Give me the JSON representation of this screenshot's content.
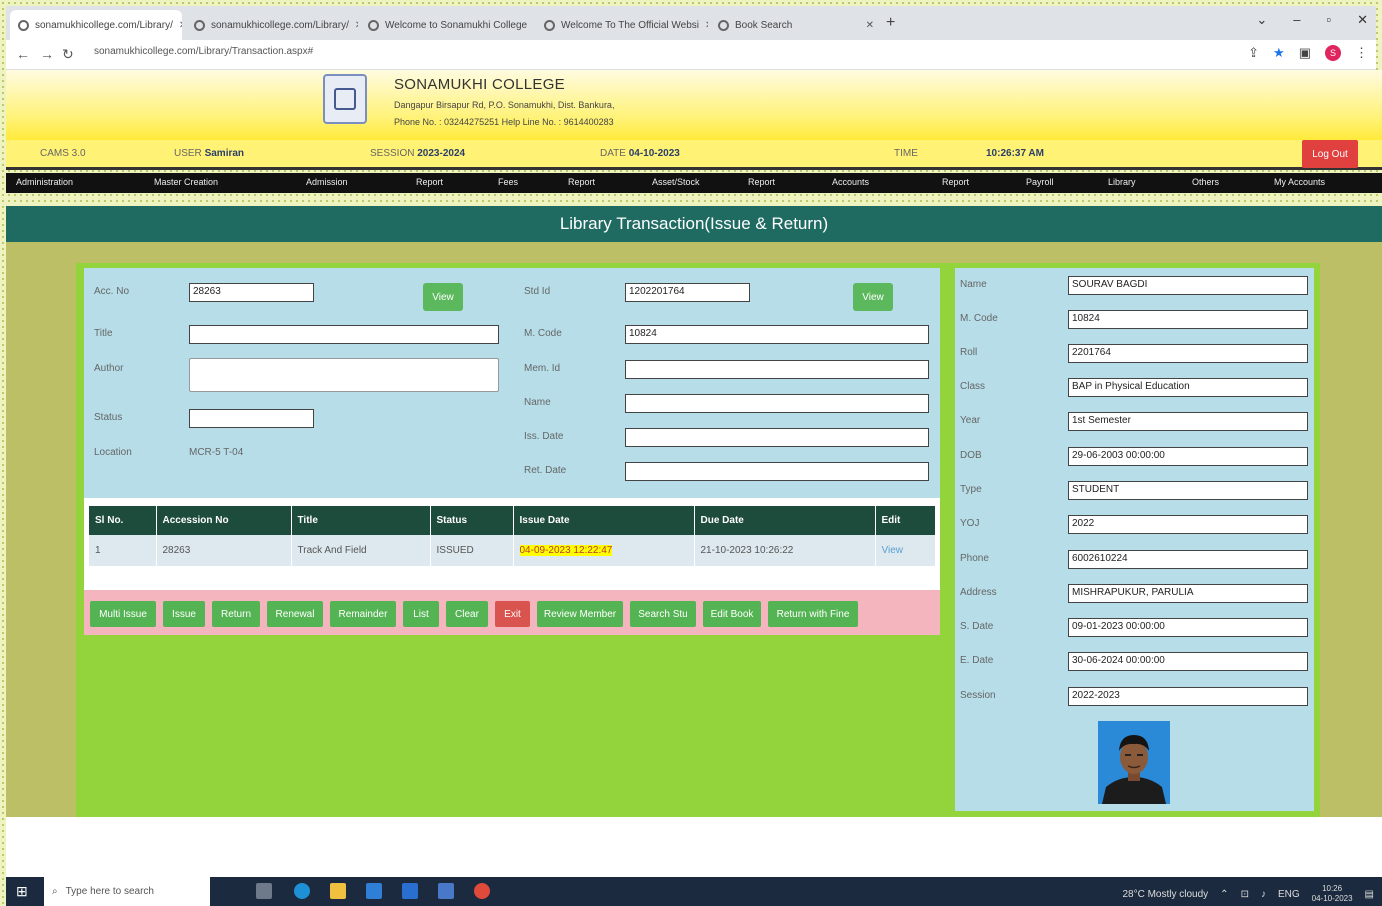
{
  "browser": {
    "tabs": [
      {
        "label": "sonamukhicollege.com/Library/"
      },
      {
        "label": "sonamukhicollege.com/Library/"
      },
      {
        "label": "Welcome to Sonamukhi College"
      },
      {
        "label": "Welcome To The Official Websi"
      },
      {
        "label": "Book Search"
      }
    ],
    "url": "sonamukhicollege.com/Library/Transaction.aspx#"
  },
  "site": {
    "college_name": "SONAMUKHI COLLEGE",
    "address": "Dangapur Birsapur Rd, P.O. Sonamukhi, Dist. Bankura,",
    "phone": "Phone No. : 03244275251  Help Line No. : 9614400283"
  },
  "info": {
    "cams_label": "CAMS 3.0",
    "user_label": "USER",
    "user_value": "Samiran",
    "session_label": "SESSION",
    "session_value": "2023-2024",
    "date_label": "DATE",
    "date_value": "04-10-2023",
    "time_label": "TIME",
    "time_value": "10:26:37 AM",
    "logout_label": "Log Out"
  },
  "menu": [
    "Administration",
    "Master Creation",
    "Admission",
    "Report",
    "Fees",
    "Report",
    "Asset/Stock",
    "Report",
    "Accounts",
    "Report",
    "Payroll",
    "Library",
    "Others",
    "My Accounts"
  ],
  "page_title": "Library Transaction(Issue & Return)",
  "form": {
    "acc_no_label": "Acc. No",
    "acc_no_value": "28263",
    "view_label": "View",
    "title_label": "Title",
    "author_label": "Author",
    "status_label": "Status",
    "location_label": "Location",
    "location_value": "MCR-5 T-04",
    "std_id_label": "Std Id",
    "std_id_value": "1202201764",
    "mcode_label": "M. Code",
    "mcode_value": "10824",
    "memid_label": "Mem. Id",
    "name_label": "Name",
    "issdate_label": "Iss. Date",
    "retdate_label": "Ret. Date"
  },
  "table": {
    "headers": [
      "Sl No.",
      "Accession No",
      "Title",
      "Status",
      "Issue Date",
      "Due Date",
      "Edit"
    ],
    "rows": [
      [
        "1",
        "28263",
        "Track And Field",
        "ISSUED",
        "04-09-2023 12:22:47",
        "21-10-2023 10:26:22",
        "View"
      ]
    ]
  },
  "buttons": [
    "Multi Issue",
    "Issue",
    "Return",
    "Renewal",
    "Remainder",
    "List",
    "Clear",
    "Exit",
    "Review Member",
    "Search Stu",
    "Edit Book",
    "Return with Fine"
  ],
  "member": [
    {
      "label": "Name",
      "value": "SOURAV BAGDI"
    },
    {
      "label": "M. Code",
      "value": "10824"
    },
    {
      "label": "Roll",
      "value": "2201764"
    },
    {
      "label": "Class",
      "value": "BAP in Physical Education"
    },
    {
      "label": "Year",
      "value": "1st Semester"
    },
    {
      "label": "DOB",
      "value": "29-06-2003 00:00:00"
    },
    {
      "label": "Type",
      "value": "STUDENT"
    },
    {
      "label": "YOJ",
      "value": "2022"
    },
    {
      "label": "Phone",
      "value": "6002610224"
    },
    {
      "label": "Address",
      "value": "MISHRAPUKUR, PARULIA"
    },
    {
      "label": "S. Date",
      "value": "09-01-2023 00:00:00"
    },
    {
      "label": "E. Date",
      "value": "30-06-2024 00:00:00"
    },
    {
      "label": "Session",
      "value": "2022-2023"
    }
  ],
  "taskbar": {
    "search_placeholder": "Type here to search",
    "weather": "28°C  Mostly cloudy",
    "lang": "ENG",
    "time": "10:26",
    "date": "04-10-2023"
  },
  "colors": {
    "header_teal": "#1f6b62",
    "panel_green": "#93d33b",
    "form_blue": "#b6dde8",
    "table_head": "#1d4b3c",
    "btn_green": "#54b454",
    "btn_red": "#d9534f",
    "logout_red": "#e0403e"
  }
}
